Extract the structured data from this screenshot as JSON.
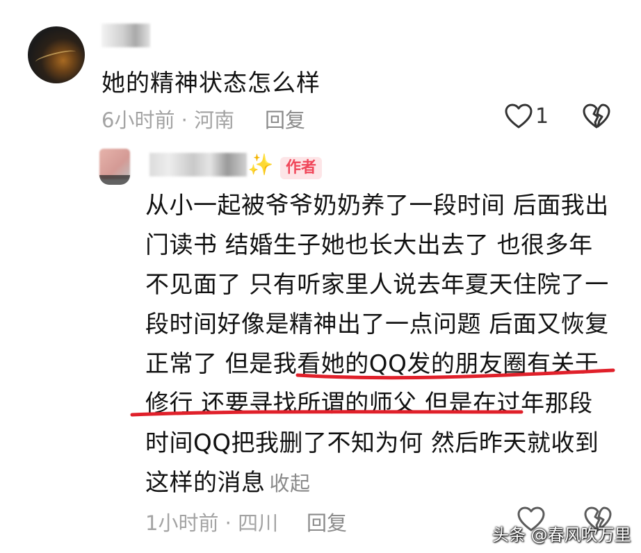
{
  "comment": {
    "username": "",
    "text": "她的精神状态怎么样",
    "time_location": "6小时前 · 河南",
    "reply_label": "回复",
    "like_count": "1",
    "icons": {
      "like": "heart-outline-icon",
      "dislike": "broken-heart-icon"
    }
  },
  "reply": {
    "username_suffix": "✨",
    "author_badge": "作者",
    "lines": [
      "从小一起被爷爷奶奶养了一段时间 后面我出",
      "门读书 结婚生子她也长大出去了 也很多年",
      "不见面了 只有听家里人说去年夏天住院了一",
      "段时间好像是精神出了一点问题 后面又恢复",
      "正常了 但是我看她的QQ发的朋友圈有关于",
      "修行 还要寻找所谓的师父 但是在过年那段",
      "时间QQ把我删了不知为何 然后昨天就收到",
      "这样的消息"
    ],
    "collapse_label": "收起",
    "time_location": "1小时前 · 四川",
    "reply_label": "回复"
  },
  "annotation": {
    "underline_color": "#e0202a"
  },
  "watermark": "头条 @春风吹万里"
}
